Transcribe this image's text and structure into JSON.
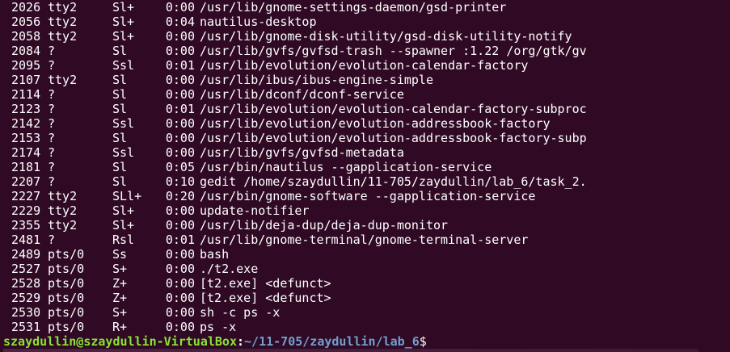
{
  "processes": [
    {
      "pid": "2026",
      "tty": "tty2",
      "stat": "Sl+",
      "time": "0:00",
      "cmd": "/usr/lib/gnome-settings-daemon/gsd-printer"
    },
    {
      "pid": "2056",
      "tty": "tty2",
      "stat": "Sl+",
      "time": "0:04",
      "cmd": "nautilus-desktop"
    },
    {
      "pid": "2058",
      "tty": "tty2",
      "stat": "Sl+",
      "time": "0:00",
      "cmd": "/usr/lib/gnome-disk-utility/gsd-disk-utility-notify"
    },
    {
      "pid": "2084",
      "tty": "?",
      "stat": "Sl",
      "time": "0:00",
      "cmd": "/usr/lib/gvfs/gvfsd-trash --spawner :1.22 /org/gtk/gv"
    },
    {
      "pid": "2095",
      "tty": "?",
      "stat": "Ssl",
      "time": "0:01",
      "cmd": "/usr/lib/evolution/evolution-calendar-factory"
    },
    {
      "pid": "2107",
      "tty": "tty2",
      "stat": "Sl",
      "time": "0:00",
      "cmd": "/usr/lib/ibus/ibus-engine-simple"
    },
    {
      "pid": "2114",
      "tty": "?",
      "stat": "Sl",
      "time": "0:00",
      "cmd": "/usr/lib/dconf/dconf-service"
    },
    {
      "pid": "2123",
      "tty": "?",
      "stat": "Sl",
      "time": "0:01",
      "cmd": "/usr/lib/evolution/evolution-calendar-factory-subproc"
    },
    {
      "pid": "2142",
      "tty": "?",
      "stat": "Ssl",
      "time": "0:00",
      "cmd": "/usr/lib/evolution/evolution-addressbook-factory"
    },
    {
      "pid": "2153",
      "tty": "?",
      "stat": "Sl",
      "time": "0:00",
      "cmd": "/usr/lib/evolution/evolution-addressbook-factory-subp"
    },
    {
      "pid": "2174",
      "tty": "?",
      "stat": "Ssl",
      "time": "0:00",
      "cmd": "/usr/lib/gvfs/gvfsd-metadata"
    },
    {
      "pid": "2181",
      "tty": "?",
      "stat": "Sl",
      "time": "0:05",
      "cmd": "/usr/bin/nautilus --gapplication-service"
    },
    {
      "pid": "2207",
      "tty": "?",
      "stat": "Sl",
      "time": "0:10",
      "cmd": "gedit /home/szaydullin/11-705/zaydullin/lab_6/task_2."
    },
    {
      "pid": "2227",
      "tty": "tty2",
      "stat": "SLl+",
      "time": "0:20",
      "cmd": "/usr/bin/gnome-software --gapplication-service"
    },
    {
      "pid": "2229",
      "tty": "tty2",
      "stat": "Sl+",
      "time": "0:00",
      "cmd": "update-notifier"
    },
    {
      "pid": "2355",
      "tty": "tty2",
      "stat": "Sl+",
      "time": "0:00",
      "cmd": "/usr/lib/deja-dup/deja-dup-monitor"
    },
    {
      "pid": "2481",
      "tty": "?",
      "stat": "Rsl",
      "time": "0:01",
      "cmd": "/usr/lib/gnome-terminal/gnome-terminal-server"
    },
    {
      "pid": "2489",
      "tty": "pts/0",
      "stat": "Ss",
      "time": "0:00",
      "cmd": "bash"
    },
    {
      "pid": "2527",
      "tty": "pts/0",
      "stat": "S+",
      "time": "0:00",
      "cmd": "./t2.exe"
    },
    {
      "pid": "2528",
      "tty": "pts/0",
      "stat": "Z+",
      "time": "0:00",
      "cmd": "[t2.exe] <defunct>"
    },
    {
      "pid": "2529",
      "tty": "pts/0",
      "stat": "Z+",
      "time": "0:00",
      "cmd": "[t2.exe] <defunct>"
    },
    {
      "pid": "2530",
      "tty": "pts/0",
      "stat": "S+",
      "time": "0:00",
      "cmd": "sh -c ps -x"
    },
    {
      "pid": "2531",
      "tty": "pts/0",
      "stat": "R+",
      "time": "0:00",
      "cmd": "ps -x"
    }
  ],
  "prompt": {
    "user_host": "szaydullin@szaydullin-VirtualBox",
    "separator": ":",
    "path": "~/11-705/zaydullin/lab_6",
    "symbol": "$"
  },
  "colors": {
    "background": "#300a24",
    "text": "#ffffff",
    "prompt_user": "#8ae234",
    "prompt_path": "#729fcf"
  }
}
